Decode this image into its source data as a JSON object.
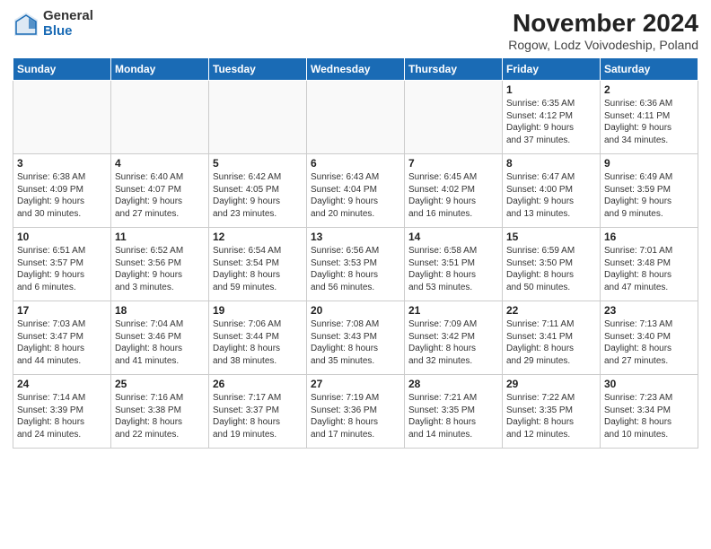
{
  "logo": {
    "general": "General",
    "blue": "Blue"
  },
  "title": "November 2024",
  "subtitle": "Rogow, Lodz Voivodeship, Poland",
  "headers": [
    "Sunday",
    "Monday",
    "Tuesday",
    "Wednesday",
    "Thursday",
    "Friday",
    "Saturday"
  ],
  "weeks": [
    [
      {
        "day": "",
        "info": ""
      },
      {
        "day": "",
        "info": ""
      },
      {
        "day": "",
        "info": ""
      },
      {
        "day": "",
        "info": ""
      },
      {
        "day": "",
        "info": ""
      },
      {
        "day": "1",
        "info": "Sunrise: 6:35 AM\nSunset: 4:12 PM\nDaylight: 9 hours\nand 37 minutes."
      },
      {
        "day": "2",
        "info": "Sunrise: 6:36 AM\nSunset: 4:11 PM\nDaylight: 9 hours\nand 34 minutes."
      }
    ],
    [
      {
        "day": "3",
        "info": "Sunrise: 6:38 AM\nSunset: 4:09 PM\nDaylight: 9 hours\nand 30 minutes."
      },
      {
        "day": "4",
        "info": "Sunrise: 6:40 AM\nSunset: 4:07 PM\nDaylight: 9 hours\nand 27 minutes."
      },
      {
        "day": "5",
        "info": "Sunrise: 6:42 AM\nSunset: 4:05 PM\nDaylight: 9 hours\nand 23 minutes."
      },
      {
        "day": "6",
        "info": "Sunrise: 6:43 AM\nSunset: 4:04 PM\nDaylight: 9 hours\nand 20 minutes."
      },
      {
        "day": "7",
        "info": "Sunrise: 6:45 AM\nSunset: 4:02 PM\nDaylight: 9 hours\nand 16 minutes."
      },
      {
        "day": "8",
        "info": "Sunrise: 6:47 AM\nSunset: 4:00 PM\nDaylight: 9 hours\nand 13 minutes."
      },
      {
        "day": "9",
        "info": "Sunrise: 6:49 AM\nSunset: 3:59 PM\nDaylight: 9 hours\nand 9 minutes."
      }
    ],
    [
      {
        "day": "10",
        "info": "Sunrise: 6:51 AM\nSunset: 3:57 PM\nDaylight: 9 hours\nand 6 minutes."
      },
      {
        "day": "11",
        "info": "Sunrise: 6:52 AM\nSunset: 3:56 PM\nDaylight: 9 hours\nand 3 minutes."
      },
      {
        "day": "12",
        "info": "Sunrise: 6:54 AM\nSunset: 3:54 PM\nDaylight: 8 hours\nand 59 minutes."
      },
      {
        "day": "13",
        "info": "Sunrise: 6:56 AM\nSunset: 3:53 PM\nDaylight: 8 hours\nand 56 minutes."
      },
      {
        "day": "14",
        "info": "Sunrise: 6:58 AM\nSunset: 3:51 PM\nDaylight: 8 hours\nand 53 minutes."
      },
      {
        "day": "15",
        "info": "Sunrise: 6:59 AM\nSunset: 3:50 PM\nDaylight: 8 hours\nand 50 minutes."
      },
      {
        "day": "16",
        "info": "Sunrise: 7:01 AM\nSunset: 3:48 PM\nDaylight: 8 hours\nand 47 minutes."
      }
    ],
    [
      {
        "day": "17",
        "info": "Sunrise: 7:03 AM\nSunset: 3:47 PM\nDaylight: 8 hours\nand 44 minutes."
      },
      {
        "day": "18",
        "info": "Sunrise: 7:04 AM\nSunset: 3:46 PM\nDaylight: 8 hours\nand 41 minutes."
      },
      {
        "day": "19",
        "info": "Sunrise: 7:06 AM\nSunset: 3:44 PM\nDaylight: 8 hours\nand 38 minutes."
      },
      {
        "day": "20",
        "info": "Sunrise: 7:08 AM\nSunset: 3:43 PM\nDaylight: 8 hours\nand 35 minutes."
      },
      {
        "day": "21",
        "info": "Sunrise: 7:09 AM\nSunset: 3:42 PM\nDaylight: 8 hours\nand 32 minutes."
      },
      {
        "day": "22",
        "info": "Sunrise: 7:11 AM\nSunset: 3:41 PM\nDaylight: 8 hours\nand 29 minutes."
      },
      {
        "day": "23",
        "info": "Sunrise: 7:13 AM\nSunset: 3:40 PM\nDaylight: 8 hours\nand 27 minutes."
      }
    ],
    [
      {
        "day": "24",
        "info": "Sunrise: 7:14 AM\nSunset: 3:39 PM\nDaylight: 8 hours\nand 24 minutes."
      },
      {
        "day": "25",
        "info": "Sunrise: 7:16 AM\nSunset: 3:38 PM\nDaylight: 8 hours\nand 22 minutes."
      },
      {
        "day": "26",
        "info": "Sunrise: 7:17 AM\nSunset: 3:37 PM\nDaylight: 8 hours\nand 19 minutes."
      },
      {
        "day": "27",
        "info": "Sunrise: 7:19 AM\nSunset: 3:36 PM\nDaylight: 8 hours\nand 17 minutes."
      },
      {
        "day": "28",
        "info": "Sunrise: 7:21 AM\nSunset: 3:35 PM\nDaylight: 8 hours\nand 14 minutes."
      },
      {
        "day": "29",
        "info": "Sunrise: 7:22 AM\nSunset: 3:35 PM\nDaylight: 8 hours\nand 12 minutes."
      },
      {
        "day": "30",
        "info": "Sunrise: 7:23 AM\nSunset: 3:34 PM\nDaylight: 8 hours\nand 10 minutes."
      }
    ]
  ]
}
